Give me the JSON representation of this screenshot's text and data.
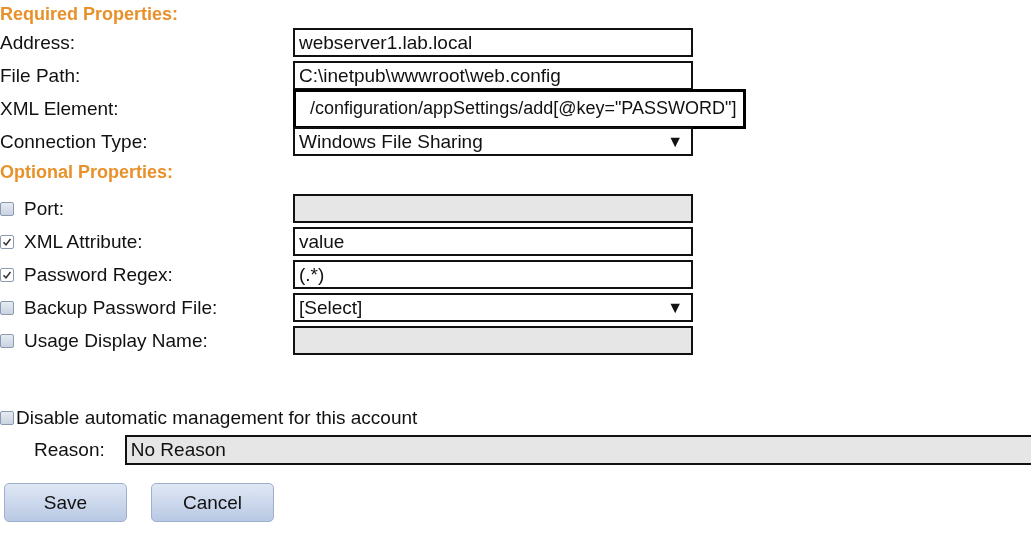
{
  "sections": [
    {
      "heading": "Required Properties:",
      "rows": [
        {
          "label": "Address:",
          "field": {
            "kind": "text",
            "value": "webserver1.lab.local",
            "disabled": false,
            "highlighted": false
          }
        },
        {
          "label": "File Path:",
          "field": {
            "kind": "text",
            "value": "C:\\inetpub\\wwwroot\\web.config",
            "disabled": false,
            "highlighted": false
          }
        },
        {
          "label": "XML Element:",
          "field": {
            "kind": "text",
            "value": "/configuration/appSettings/add[@key=\"PASSWORD\"]",
            "disabled": false,
            "highlighted": true
          }
        },
        {
          "label": "Connection Type:",
          "field": {
            "kind": "select",
            "value": "Windows File Sharing",
            "arrow": "▼",
            "disabled": false,
            "highlighted": false
          }
        }
      ]
    },
    {
      "heading": "Optional Properties:",
      "rows": [
        {
          "label": "Port:",
          "checked": false,
          "field": {
            "kind": "text",
            "disabled": true,
            "highlighted": false
          }
        },
        {
          "label": "XML Attribute:",
          "checked": true,
          "field": {
            "kind": "text",
            "value": "value",
            "disabled": false,
            "highlighted": false
          }
        },
        {
          "label": "Password Regex:",
          "checked": true,
          "field": {
            "kind": "text",
            "value": "(.*)",
            "disabled": false,
            "highlighted": false
          }
        },
        {
          "label": "Backup Password File:",
          "checked": false,
          "field": {
            "kind": "select",
            "value": "[Select]",
            "arrow": "▼",
            "disabled": false,
            "highlighted": false
          }
        },
        {
          "label": "Usage Display Name:",
          "checked": false,
          "field": {
            "kind": "text",
            "disabled": true,
            "highlighted": false
          }
        }
      ]
    }
  ],
  "disable_management": {
    "label": "Disable automatic management for this account",
    "checked": false
  },
  "reason": {
    "label": "Reason:",
    "value": "No Reason",
    "disabled": true
  },
  "buttons": [
    "Save",
    "Cancel"
  ]
}
